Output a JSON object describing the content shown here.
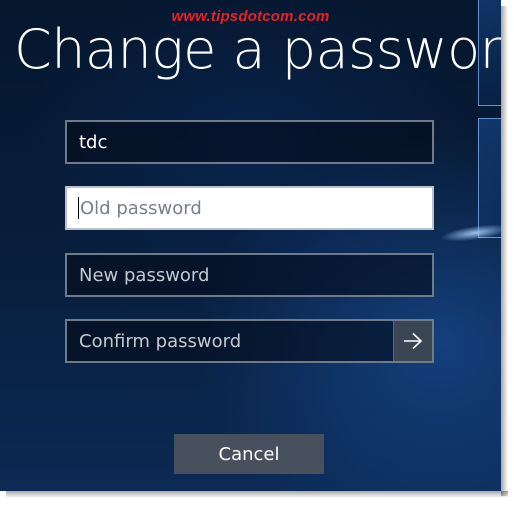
{
  "watermark": "www.tipsdotcom.com",
  "page": {
    "title": "Change a password"
  },
  "form": {
    "username_value": "tdc",
    "old_password_placeholder": "Old password",
    "new_password_placeholder": "New password",
    "confirm_password_placeholder": "Confirm password",
    "submit_icon": "arrow-right-icon"
  },
  "actions": {
    "cancel_label": "Cancel"
  },
  "colors": {
    "watermark": "#e8202a",
    "background": "#081d3a",
    "field_border": "#6f7b89",
    "focused_field_bg": "#ffffff",
    "cancel_bg": "#47505c"
  }
}
